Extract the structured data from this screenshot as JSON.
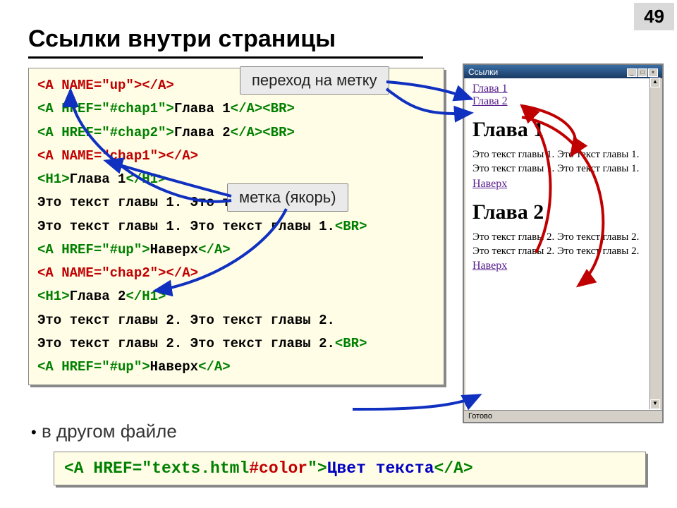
{
  "slide": {
    "number": "49",
    "title": "Ссылки внутри страницы",
    "bullet": "в другом файле"
  },
  "callouts": {
    "top": "переход на метку",
    "mid": "метка (якорь)"
  },
  "code1": {
    "l1a": "<A NAME=\"up\"></A>",
    "l2a": "<A HREF=\"#chap1\">",
    "l2b": "Глава 1",
    "l2c": "</A><BR>",
    "l3a": "<A HREF=\"#chap2\">",
    "l3b": "Глава 2",
    "l3c": "</A><BR>",
    "l4a": "<A NAME=\"chap1\"></A>",
    "l5a": "<H1>",
    "l5b": "Глава 1",
    "l5c": "</H1>",
    "l6": "Это текст главы 1. Это текст главы 1.",
    "l7a": "Это текст главы 1. Это текст главы 1.",
    "l7b": "<BR>",
    "l8a": "<A HREF=\"#up\">",
    "l8b": "Наверх",
    "l8c": "</A>",
    "l9a": "<A NAME=\"chap2\"></A>",
    "l10a": "<H1>",
    "l10b": "Глава 2",
    "l10c": "</H1>",
    "l11": "Это текст главы 2. Это текст главы 2.",
    "l12a": "Это текст главы 2. Это текст главы 2.",
    "l12b": "<BR>",
    "l13a": "<A HREF=\"#up\">",
    "l13b": "Наверх",
    "l13c": "</A>"
  },
  "code2": {
    "a": "<A HREF=\"texts.html",
    "b": "#color",
    "c": "\">",
    "d": "Цвет текста",
    "e": "</A>"
  },
  "browser": {
    "title": "Ссылки",
    "status": "Готово",
    "link1": "Глава 1",
    "link2": "Глава 2",
    "h1": "Глава 1",
    "p1": "Это текст главы 1. Это текст главы 1. Это текст главы 1. Это текст главы 1.",
    "up1": "Наверх",
    "h2": "Глава 2",
    "p2": "Это текст главы 2. Это текст главы 2. Это текст главы 2. Это текст главы 2.",
    "up2": "Наверх"
  }
}
